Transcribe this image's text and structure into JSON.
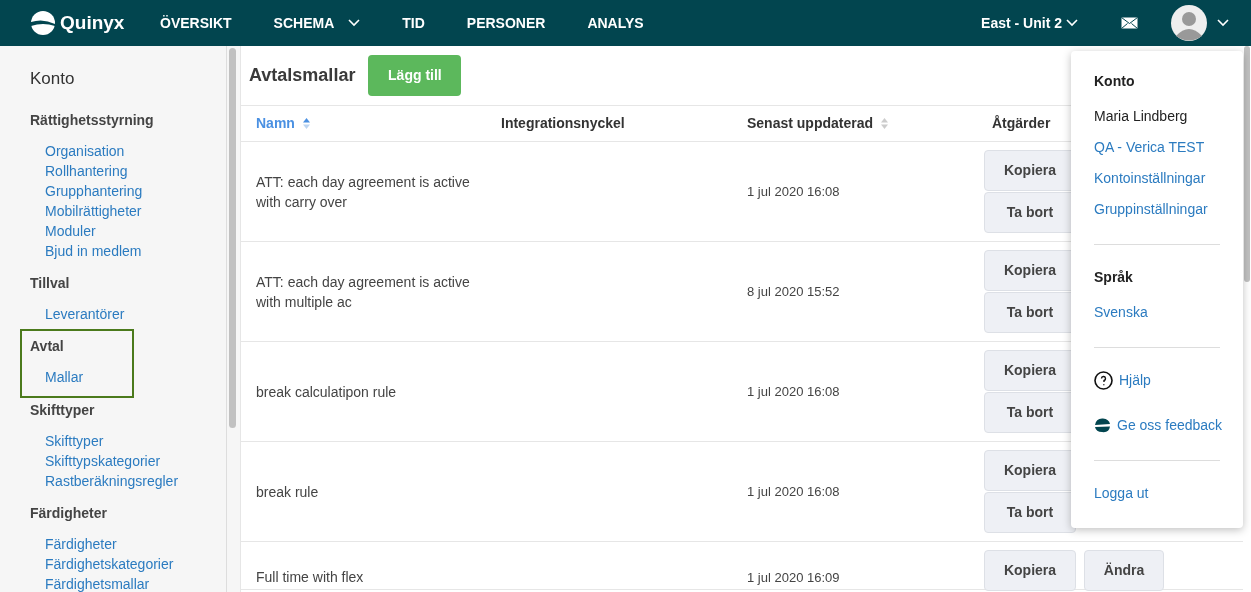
{
  "top_nav": {
    "logo": "Quinyx",
    "items": [
      {
        "label": "ÖVERSIKT",
        "has_menu": false
      },
      {
        "label": "SCHEMA",
        "has_menu": true
      },
      {
        "label": "TID",
        "has_menu": false
      },
      {
        "label": "PERSONER",
        "has_menu": false
      },
      {
        "label": "ANALYS",
        "has_menu": false
      }
    ],
    "unit": "East - Unit 2"
  },
  "sidebar": {
    "title": "Konto",
    "sections": [
      {
        "heading": "Rättighetsstyrning",
        "highlighted": false,
        "items": [
          "Organisation",
          "Rollhantering",
          "Grupphantering",
          "Mobilrättigheter",
          "Moduler",
          "Bjud in medlem"
        ]
      },
      {
        "heading": "Tillval",
        "highlighted": false,
        "items": [
          "Leverantörer"
        ]
      },
      {
        "heading": "Avtal",
        "highlighted": true,
        "items": [
          "Mallar"
        ]
      },
      {
        "heading": "Skifttyper",
        "highlighted": false,
        "items": [
          "Skifttyper",
          "Skifttypskategorier",
          "Rastberäkningsregler"
        ]
      },
      {
        "heading": "Färdigheter",
        "highlighted": false,
        "items": [
          "Färdigheter",
          "Färdighetskategorier",
          "Färdighetsmallar"
        ]
      }
    ]
  },
  "page": {
    "title": "Avtalsmallar",
    "add_button": "Lägg till"
  },
  "table": {
    "columns": [
      {
        "label": "Namn",
        "sortable": true,
        "sorted": true
      },
      {
        "label": "Integrationsnyckel",
        "sortable": false,
        "sorted": false
      },
      {
        "label": "Senast uppdaterad",
        "sortable": true,
        "sorted": false
      },
      {
        "label": "Åtgärder",
        "sortable": false,
        "sorted": false
      }
    ],
    "rows": [
      {
        "name": "ATT: each day agreement is active with carry over",
        "updated": "1 jul 2020 16:08",
        "actions": [
          {
            "kind": "copy",
            "label": "Kopiera"
          },
          {
            "kind": "delete",
            "label": "Ta bort"
          }
        ]
      },
      {
        "name": "ATT: each day agreement is active with multiple ac",
        "updated": "8 jul 2020 15:52",
        "actions": [
          {
            "kind": "copy",
            "label": "Kopiera"
          },
          {
            "kind": "delete",
            "label": "Ta bort"
          }
        ]
      },
      {
        "name": "break calculatipon rule",
        "updated": "1 jul 2020 16:08",
        "actions": [
          {
            "kind": "copy",
            "label": "Kopiera"
          },
          {
            "kind": "delete",
            "label": "Ta bort"
          }
        ]
      },
      {
        "name": "break rule",
        "updated": "1 jul 2020 16:08",
        "actions": [
          {
            "kind": "copy",
            "label": "Kopiera"
          },
          {
            "kind": "delete",
            "label": "Ta bort"
          }
        ]
      },
      {
        "name": "Full time with flex",
        "updated": "1 jul 2020 16:09",
        "actions": [
          {
            "kind": "copy",
            "label": "Kopiera"
          },
          {
            "kind": "edit",
            "label": "Ändra"
          }
        ]
      }
    ]
  },
  "user_menu": {
    "sections": [
      {
        "heading": "Konto",
        "entries": [
          {
            "kind": "text",
            "label": "Maria Lindberg"
          },
          {
            "kind": "link",
            "label": "QA - Verica TEST"
          },
          {
            "kind": "link",
            "label": "Kontoinställningar"
          },
          {
            "kind": "link",
            "label": "Gruppinställningar"
          }
        ]
      },
      {
        "heading": "Språk",
        "entries": [
          {
            "kind": "link",
            "label": "Svenska"
          }
        ]
      },
      {
        "entries": [
          {
            "kind": "help",
            "label": "Hjälp"
          },
          {
            "kind": "feedback",
            "label": "Ge oss feedback"
          }
        ]
      },
      {
        "entries": [
          {
            "kind": "link",
            "label": "Logga ut"
          }
        ]
      }
    ]
  }
}
